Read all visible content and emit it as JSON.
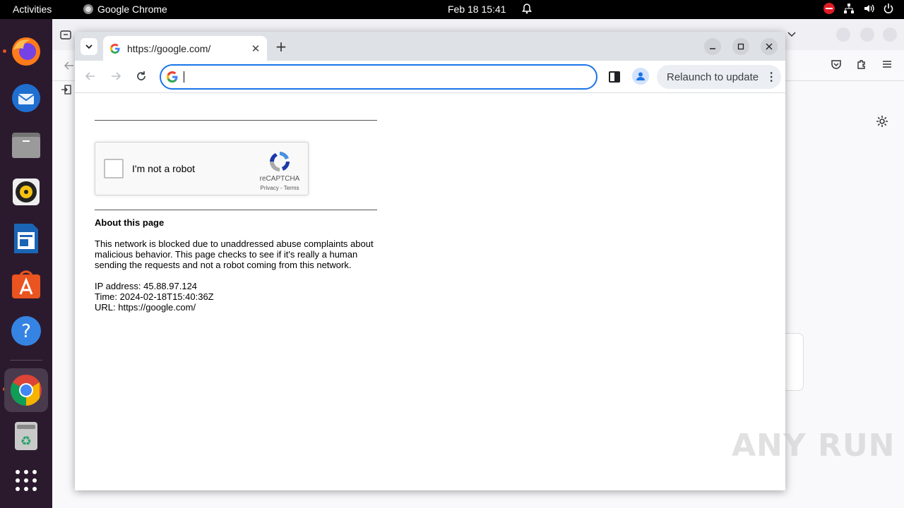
{
  "topbar": {
    "activities": "Activities",
    "app_name": "Google Chrome",
    "clock": "Feb 18  15:41"
  },
  "dock": {
    "apps": [
      "firefox-icon",
      "thunderbird-icon",
      "files-icon",
      "rhythmbox-icon",
      "libreoffice-writer-icon",
      "app-center-icon",
      "help-icon",
      "chrome-icon",
      "trash-icon",
      "show-apps-icon"
    ]
  },
  "chrome": {
    "tab_title": "https://google.com/",
    "omnibox_value": "",
    "relaunch_label": "Relaunch to update"
  },
  "page": {
    "captcha_label": "I'm not a robot",
    "captcha_brand": "reCAPTCHA",
    "captcha_links": "Privacy - Terms",
    "about_heading": "About this page",
    "about_text": "This network is blocked due to unaddressed abuse complaints about malicious behavior. This page checks to see if it's really a human sending the requests and not a robot coming from this network.",
    "ip_line": "IP address: 45.88.97.124",
    "time_line": "Time: 2024-02-18T15:40:36Z",
    "url_line": "URL: https://google.com/"
  },
  "watermark": "ANY RUN",
  "colors": {
    "accent": "#1a73e8",
    "dock_bg": "#2b1a2e",
    "ubuntu_orange": "#e95420"
  }
}
